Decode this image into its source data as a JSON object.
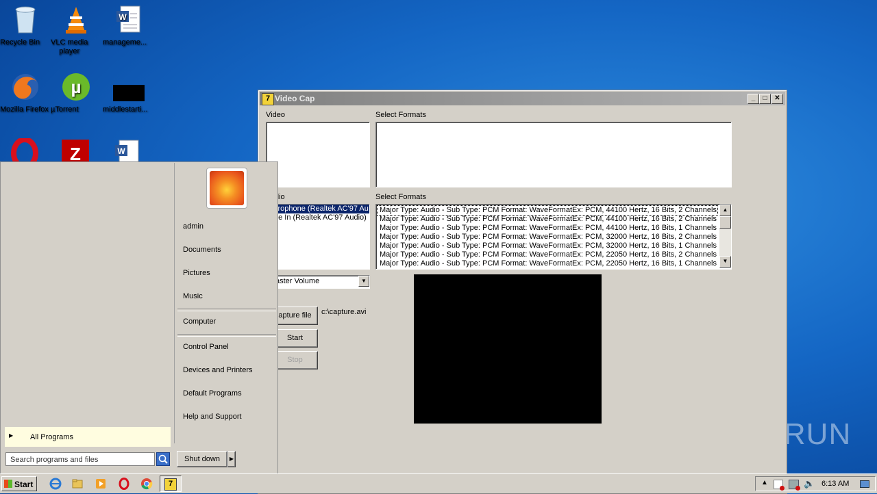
{
  "desktop": {
    "icons": [
      {
        "label": "Recycle Bin"
      },
      {
        "label": "VLC media player"
      },
      {
        "label": "manageme..."
      },
      {
        "label": "Mozilla Firefox"
      },
      {
        "label": "µTorrent"
      },
      {
        "label": "middlestarti..."
      }
    ]
  },
  "window": {
    "title": "Video Cap",
    "video_label": "Video",
    "select_formats_label_1": "Select Formats",
    "audio_label": "dio",
    "select_formats_label_2": "Select Formats",
    "audio_devices": [
      "crophone (Realtek AC'97 Au",
      "ne In (Realtek AC'97 Audio)"
    ],
    "audio_formats": [
      "Major Type: Audio - Sub Type: PCM Format: WaveFormatEx: PCM, 44100 Hertz, 16 Bits, 2 Channels",
      "Major Type: Audio - Sub Type: PCM Format: WaveFormatEx: PCM, 44100 Hertz, 16 Bits, 2 Channels",
      "Major Type: Audio - Sub Type: PCM Format: WaveFormatEx: PCM, 44100 Hertz, 16 Bits, 1 Channels",
      "Major Type: Audio - Sub Type: PCM Format: WaveFormatEx: PCM, 32000 Hertz, 16 Bits, 2 Channels",
      "Major Type: Audio - Sub Type: PCM Format: WaveFormatEx: PCM, 32000 Hertz, 16 Bits, 1 Channels",
      "Major Type: Audio - Sub Type: PCM Format: WaveFormatEx: PCM, 22050 Hertz, 16 Bits, 2 Channels",
      "Major Type: Audio - Sub Type: PCM Format: WaveFormatEx: PCM, 22050 Hertz, 16 Bits, 1 Channels"
    ],
    "mixer_select": "aster Volume",
    "capture_file_button": "apture file",
    "capture_path": "c:\\capture.avi",
    "start_button": "Start",
    "stop_button": "Stop"
  },
  "start_menu": {
    "user_items": [
      "admin",
      "Documents",
      "Pictures",
      "Music"
    ],
    "computer": "Computer",
    "system_items": [
      "Control Panel",
      "Devices and Printers",
      "Default Programs",
      "Help and Support"
    ],
    "all_programs": "All Programs",
    "search_placeholder": "Search programs and files",
    "shutdown": "Shut down"
  },
  "taskbar": {
    "start_label": "Start",
    "clock": "6:13 AM"
  },
  "watermark": "ANY RUN"
}
